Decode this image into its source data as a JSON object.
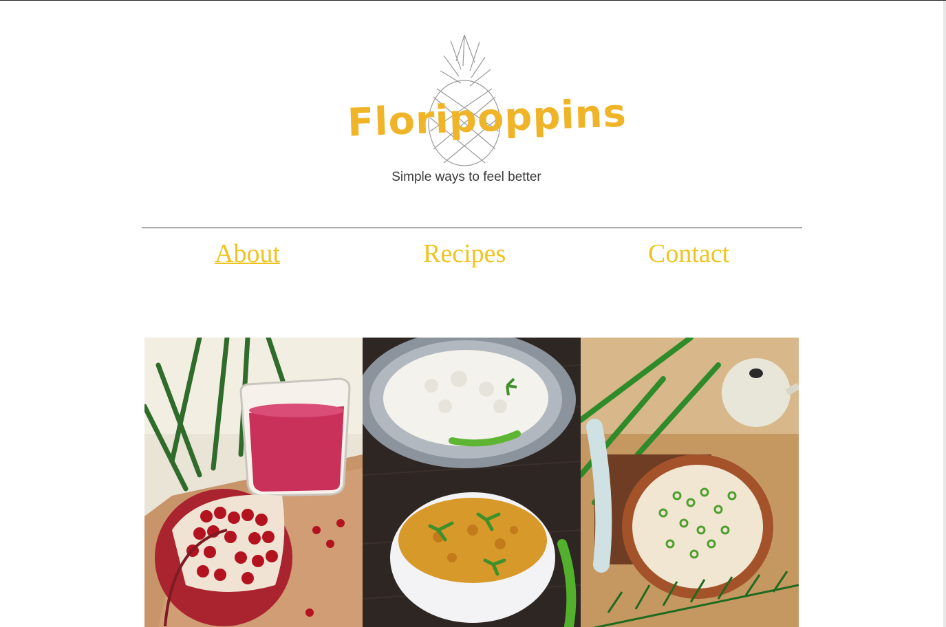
{
  "brand": {
    "name": "Floripoppins",
    "tagline": "Simple ways to feel better",
    "logo_icon": "pineapple-icon",
    "accent_color": "#f0b429",
    "nav_color": "#f0c31e"
  },
  "nav": {
    "items": [
      {
        "label": "About",
        "active": true
      },
      {
        "label": "Recipes",
        "active": false
      },
      {
        "label": "Contact",
        "active": false
      }
    ]
  },
  "gallery": {
    "tiles": [
      {
        "name": "pomegranate-juice-photo",
        "icon": "pomegranate-icon"
      },
      {
        "name": "rice-and-dal-photo",
        "icon": "bowl-icon"
      },
      {
        "name": "miso-soup-photo",
        "icon": "soup-bowl-icon"
      }
    ]
  }
}
